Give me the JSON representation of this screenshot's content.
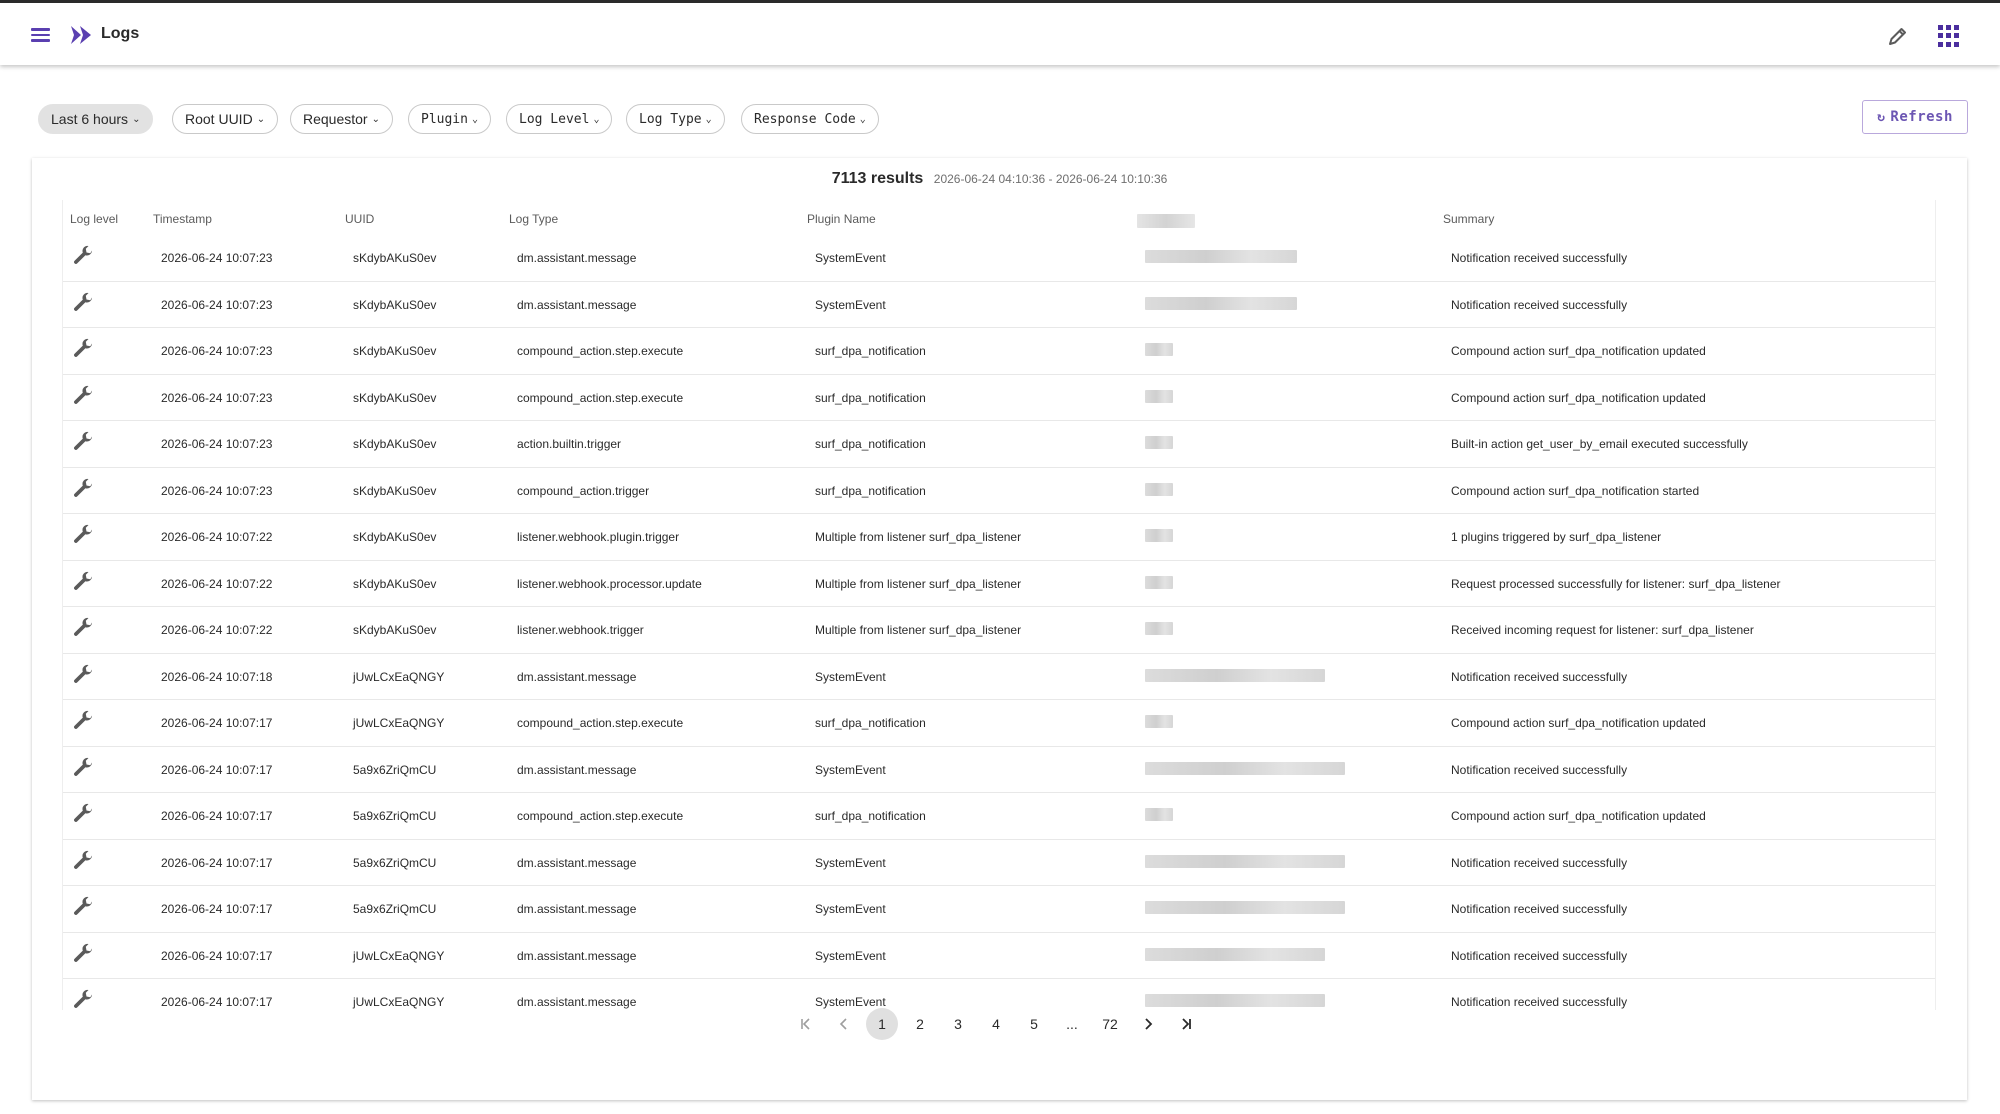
{
  "app": {
    "title": "Logs",
    "menu_icon": "menu-icon",
    "logo_icon": "double-chevron-logo-icon",
    "brand_color": "#5a3fb0"
  },
  "header_actions": {
    "edit_icon": "pen-icon",
    "apps_icon": "apps-grid-icon"
  },
  "filters": [
    {
      "label": "Last 6 hours",
      "active": true
    },
    {
      "label": "Root UUID"
    },
    {
      "label": "Requestor"
    },
    {
      "label": "Plugin"
    },
    {
      "label": "Log Level"
    },
    {
      "label": "Log Type"
    },
    {
      "label": "Response Code"
    }
  ],
  "refresh": {
    "label": "Refresh",
    "icon": "refresh-icon"
  },
  "results": {
    "count_label": "7113 results",
    "range": "2026-06-24 04:10:36 - 2026-06-24 10:10:36"
  },
  "table": {
    "columns": [
      "Log level",
      "Timestamp",
      "UUID",
      "Log Type",
      "Plugin Name",
      "Summary"
    ],
    "level_icon": "wrench-icon",
    "rows": [
      {
        "timestamp": "2026-06-24 10:07:23",
        "uuid": "sKdybAKuS0ev",
        "log_type": "dm.assistant.message",
        "plugin": "SystemEvent",
        "summary": "Notification received successfully"
      },
      {
        "timestamp": "2026-06-24 10:07:23",
        "uuid": "sKdybAKuS0ev",
        "log_type": "dm.assistant.message",
        "plugin": "SystemEvent",
        "summary": "Notification received successfully"
      },
      {
        "timestamp": "2026-06-24 10:07:23",
        "uuid": "sKdybAKuS0ev",
        "log_type": "compound_action.step.execute",
        "plugin": "surf_dpa_notification",
        "summary": "Compound action surf_dpa_notification updated"
      },
      {
        "timestamp": "2026-06-24 10:07:23",
        "uuid": "sKdybAKuS0ev",
        "log_type": "compound_action.step.execute",
        "plugin": "surf_dpa_notification",
        "summary": "Compound action surf_dpa_notification updated"
      },
      {
        "timestamp": "2026-06-24 10:07:23",
        "uuid": "sKdybAKuS0ev",
        "log_type": "action.builtin.trigger",
        "plugin": "surf_dpa_notification",
        "summary": "Built-in action get_user_by_email executed successfully"
      },
      {
        "timestamp": "2026-06-24 10:07:23",
        "uuid": "sKdybAKuS0ev",
        "log_type": "compound_action.trigger",
        "plugin": "surf_dpa_notification",
        "summary": "Compound action surf_dpa_notification started"
      },
      {
        "timestamp": "2026-06-24 10:07:22",
        "uuid": "sKdybAKuS0ev",
        "log_type": "listener.webhook.plugin.trigger",
        "plugin": "Multiple from listener surf_dpa_listener",
        "summary": "1 plugins triggered by surf_dpa_listener"
      },
      {
        "timestamp": "2026-06-24 10:07:22",
        "uuid": "sKdybAKuS0ev",
        "log_type": "listener.webhook.processor.update",
        "plugin": "Multiple from listener surf_dpa_listener",
        "summary": "Request processed successfully for listener: surf_dpa_listener"
      },
      {
        "timestamp": "2026-06-24 10:07:22",
        "uuid": "sKdybAKuS0ev",
        "log_type": "listener.webhook.trigger",
        "plugin": "Multiple from listener surf_dpa_listener",
        "summary": "Received incoming request for listener: surf_dpa_listener"
      },
      {
        "timestamp": "2026-06-24 10:07:18",
        "uuid": "jUwLCxEaQNGY",
        "log_type": "dm.assistant.message",
        "plugin": "SystemEvent",
        "summary": "Notification received successfully"
      },
      {
        "timestamp": "2026-06-24 10:07:17",
        "uuid": "jUwLCxEaQNGY",
        "log_type": "compound_action.step.execute",
        "plugin": "surf_dpa_notification",
        "summary": "Compound action surf_dpa_notification updated"
      },
      {
        "timestamp": "2026-06-24 10:07:17",
        "uuid": "5a9x6ZriQmCU",
        "log_type": "dm.assistant.message",
        "plugin": "SystemEvent",
        "summary": "Notification received successfully"
      },
      {
        "timestamp": "2026-06-24 10:07:17",
        "uuid": "5a9x6ZriQmCU",
        "log_type": "compound_action.step.execute",
        "plugin": "surf_dpa_notification",
        "summary": "Compound action surf_dpa_notification updated"
      },
      {
        "timestamp": "2026-06-24 10:07:17",
        "uuid": "5a9x6ZriQmCU",
        "log_type": "dm.assistant.message",
        "plugin": "SystemEvent",
        "summary": "Notification received successfully"
      },
      {
        "timestamp": "2026-06-24 10:07:17",
        "uuid": "5a9x6ZriQmCU",
        "log_type": "dm.assistant.message",
        "plugin": "SystemEvent",
        "summary": "Notification received successfully"
      },
      {
        "timestamp": "2026-06-24 10:07:17",
        "uuid": "jUwLCxEaQNGY",
        "log_type": "dm.assistant.message",
        "plugin": "SystemEvent",
        "summary": "Notification received successfully"
      },
      {
        "timestamp": "2026-06-24 10:07:17",
        "uuid": "jUwLCxEaQNGY",
        "log_type": "dm.assistant.message",
        "plugin": "SystemEvent",
        "summary": "Notification received successfully"
      }
    ]
  },
  "pagination": {
    "first_icon": "first-page-icon",
    "prev_icon": "chevron-left-icon",
    "next_icon": "chevron-right-icon",
    "last_icon": "last-page-icon",
    "pages": [
      "1",
      "2",
      "3",
      "4",
      "5",
      "...",
      "72"
    ],
    "current": "1"
  }
}
